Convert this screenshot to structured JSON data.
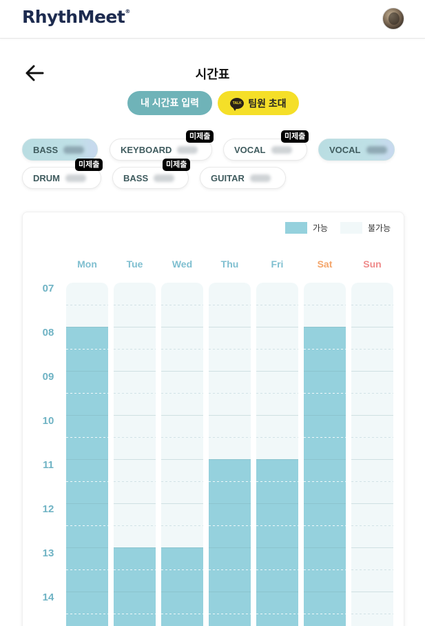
{
  "header": {
    "logo_text": "RhythMeet",
    "logo_mark": "®"
  },
  "page": {
    "title": "시간표"
  },
  "actions": {
    "input_label": "내 시간표 입력",
    "invite_label": "팀원 초대",
    "talk_icon_text": "TALK"
  },
  "members": [
    {
      "role": "BASS",
      "status": "",
      "active": true
    },
    {
      "role": "KEYBOARD",
      "status": "미제출",
      "active": false
    },
    {
      "role": "VOCAL",
      "status": "미제출",
      "active": false
    },
    {
      "role": "VOCAL",
      "status": "",
      "active": true
    },
    {
      "role": "DRUM",
      "status": "미제출",
      "active": false
    },
    {
      "role": "BASS",
      "status": "미제출",
      "active": false
    },
    {
      "role": "GUITAR",
      "status": "",
      "active": false
    }
  ],
  "legend": {
    "available": "가능",
    "unavailable": "불가능"
  },
  "colors": {
    "available": "#95d1dd",
    "unavailable": "#f1f8f9",
    "weekday": "#7fbfd0",
    "sat": "#f4a56a",
    "sun": "#ef8a8a",
    "accent": "#6fb3b8",
    "kakao": "#f5df28"
  },
  "days": [
    "Mon",
    "Tue",
    "Wed",
    "Thu",
    "Fri",
    "Sat",
    "Sun"
  ],
  "hours": [
    "07",
    "08",
    "09",
    "10",
    "11",
    "12",
    "13",
    "14"
  ],
  "availability": [
    {
      "day": "Mon",
      "from": "08:00"
    },
    {
      "day": "Tue",
      "from": "13:00"
    },
    {
      "day": "Wed",
      "from": "13:00"
    },
    {
      "day": "Thu",
      "from": "11:00"
    },
    {
      "day": "Fri",
      "from": "11:00"
    },
    {
      "day": "Sat",
      "from": "08:00"
    },
    {
      "day": "Sun",
      "from": null
    }
  ]
}
